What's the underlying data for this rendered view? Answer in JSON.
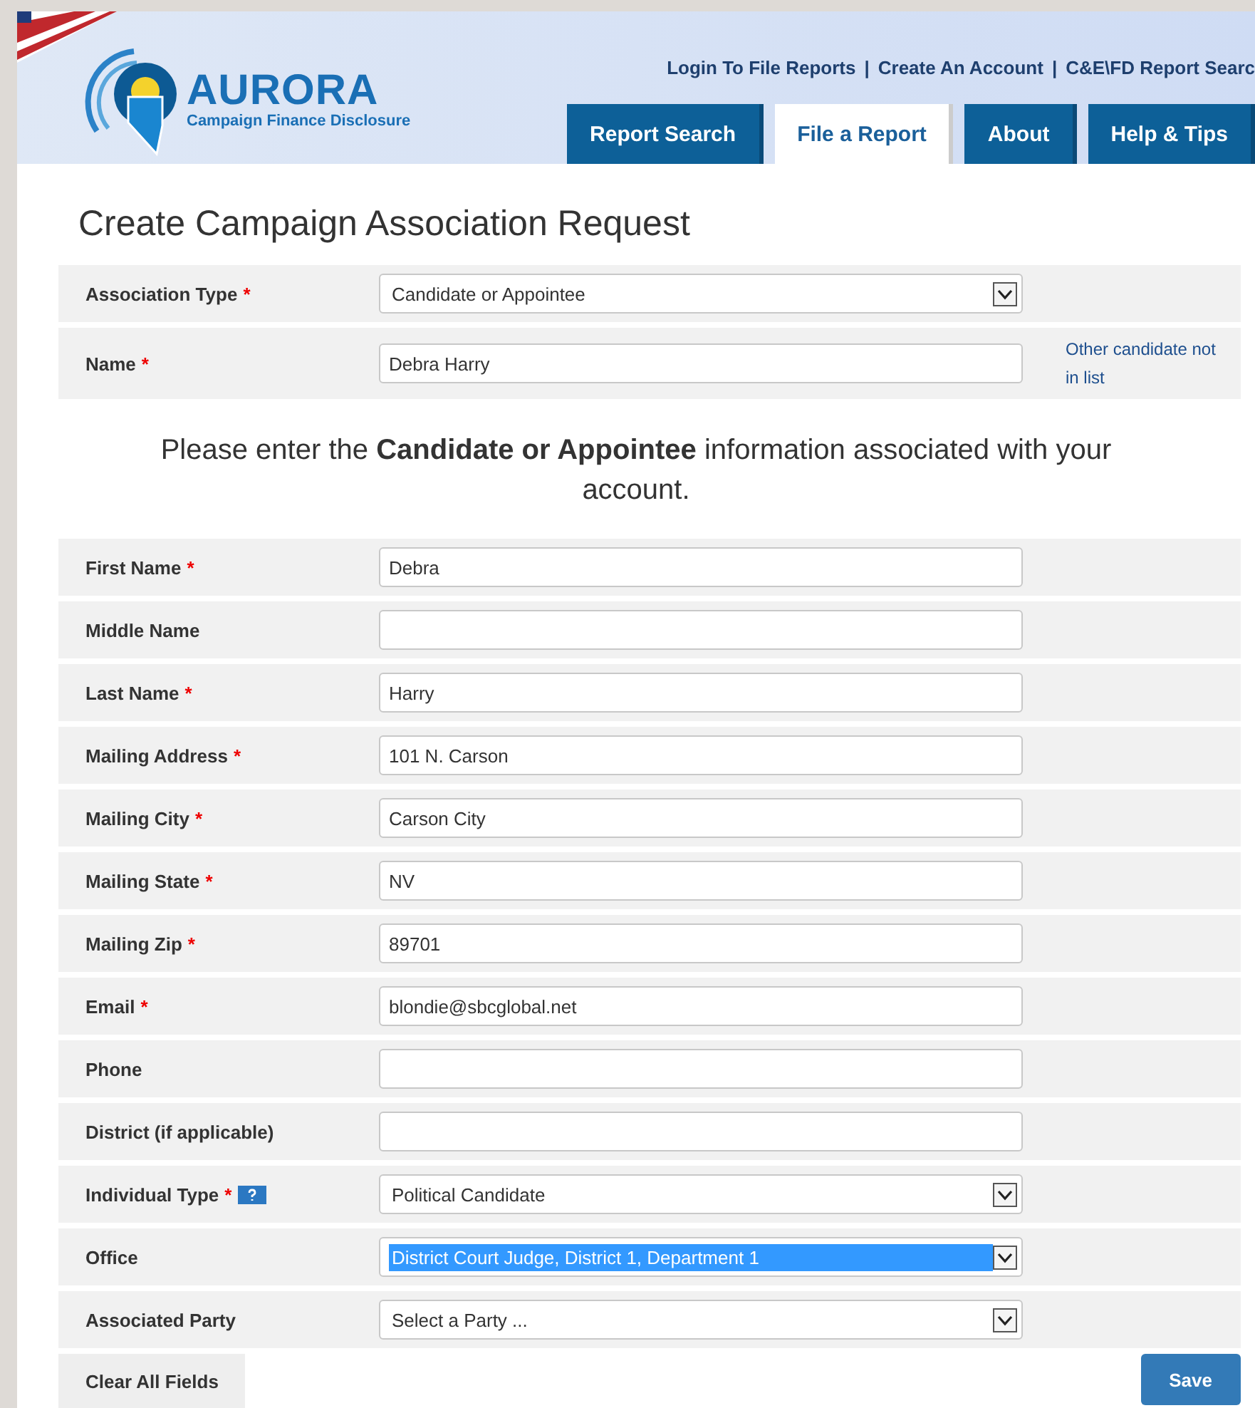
{
  "header": {
    "logo_title": "AURORA",
    "logo_subtitle": "Campaign Finance Disclosure",
    "links": [
      "Login To File Reports",
      "Create An Account",
      "C&E\\FD Report Searc"
    ],
    "link_separator": "|",
    "tabs": [
      {
        "label": "Report Search",
        "selected": false
      },
      {
        "label": "File a Report",
        "selected": true
      },
      {
        "label": "About",
        "selected": false
      },
      {
        "label": "Help & Tips",
        "selected": false
      }
    ]
  },
  "page_title": "Create Campaign Association Request",
  "association": [
    {
      "label": "Association Type",
      "required_mark": "*",
      "kind": "select",
      "value": "Candidate or Appointee",
      "highlighted": false
    },
    {
      "label": "Name",
      "required_mark": "*",
      "kind": "text",
      "value": "Debra Harry",
      "side_link": "Other candidate not in list"
    }
  ],
  "instruction": "Please enter the **Candidate or Appointee** information associated with your account.",
  "fields": [
    {
      "label": "First Name",
      "required_mark": "*",
      "kind": "text",
      "value": "Debra"
    },
    {
      "label": "Middle Name",
      "kind": "text"
    },
    {
      "label": "Last Name",
      "required_mark": "*",
      "kind": "text",
      "value": "Harry"
    },
    {
      "label": "Mailing Address",
      "required_mark": "*",
      "kind": "text",
      "value": "101 N. Carson"
    },
    {
      "label": "Mailing City",
      "required_mark": "*",
      "kind": "text",
      "value": "Carson City"
    },
    {
      "label": "Mailing State",
      "required_mark": "*",
      "kind": "text",
      "value": "NV"
    },
    {
      "label": "Mailing Zip",
      "required_mark": "*",
      "kind": "text",
      "value": "89701"
    },
    {
      "label": "Email",
      "required_mark": "*",
      "kind": "text",
      "value": "blondie@sbcglobal.net"
    },
    {
      "label": "Phone",
      "kind": "text"
    },
    {
      "label": "District (if applicable)",
      "kind": "text"
    },
    {
      "label": "Individual Type",
      "required_mark": "*",
      "help": true,
      "kind": "select",
      "value": "Political Candidate",
      "highlighted": false
    },
    {
      "label": "Office",
      "kind": "select",
      "value": "District Court Judge, District 1, Department 1",
      "highlighted": true
    },
    {
      "label": "Associated Party",
      "kind": "select",
      "value": "Select a Party ...",
      "highlighted": false
    }
  ],
  "buttons": {
    "clear": "Clear All Fields",
    "save": "Save"
  }
}
